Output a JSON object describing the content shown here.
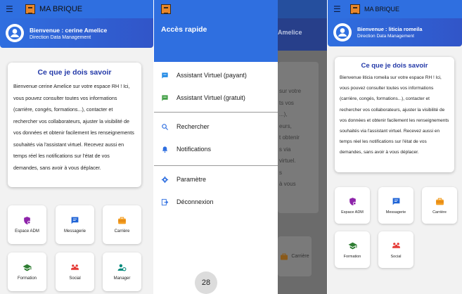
{
  "app": {
    "title": "MA BRIQUE"
  },
  "left": {
    "welcome": "Bienvenue : cerine Amelice",
    "department": "Direction Data Management",
    "card_title": "Ce que je dois savoir",
    "card_text": "Bienvenue cerine Amelice sur votre espace RH ! Ici, vous pouvez consulter toutes vos informations (carrière, congés, formations...), contacter et rechercher vos collaborateurs, ajuster la visibilité de vos données et obtenir facilement les renseignements souhaités via l'assistant virtuel. Recevez aussi en temps réel les notifications sur l'état de vos demandes, sans avoir à vous déplacer.",
    "tiles": [
      "Espace ADM",
      "Messagerie",
      "Carrière",
      "Formation",
      "Social",
      "Manager"
    ]
  },
  "drawer": {
    "title": "Accès rapide",
    "items": [
      "Assistant Virtuel (payant)",
      "Assistant Virtuel (gratuit)",
      "Rechercher",
      "Notifications",
      "Paramètre",
      "Déconnexion"
    ],
    "page_number": "28",
    "bg_user": "Amelice",
    "bg_card_lines": [
      "sur votre",
      "ts vos",
      "...),",
      "eurs,",
      "t obtenir",
      "s via",
      "virtuel.",
      "s",
      "à vous"
    ],
    "bg_tile": "Carrière"
  },
  "right": {
    "welcome": "Bienvenue : liticia romeila",
    "department": "Direction Data Management",
    "card_title": "Ce que je dois savoir",
    "card_text": "Bienvenue liticia romeila sur votre espace RH ! Ici, vous pouvez consulter toutes vos informations (carrière, congés, formations...), contacter et rechercher vos collaborateurs, ajuster la visibilité de vos données et obtenir facilement les renseignements souhaités via l'assistant virtuel. Recevez aussi en temps réel les notifications sur l'état de vos demandes, sans avoir à vous déplacer.",
    "tiles": [
      "Espace ADM",
      "Messagerie",
      "Carrière",
      "Formation",
      "Social"
    ]
  },
  "colors": {
    "primary": "#2f6fe0",
    "heading": "#2339a8",
    "espace": "#8e24aa",
    "messagerie": "#1e63d6",
    "carriere": "#f39c1f",
    "formation": "#2e7d32",
    "social": "#e53935",
    "manager": "#00897b"
  }
}
